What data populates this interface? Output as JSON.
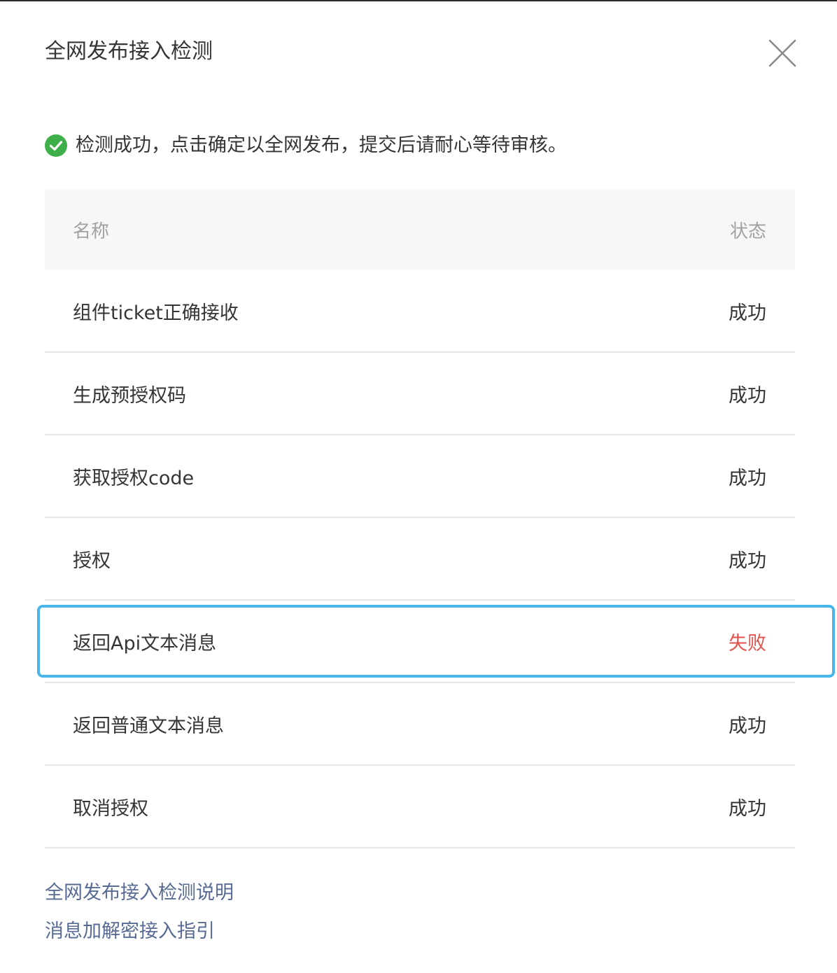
{
  "dialog": {
    "title": "全网发布接入检测",
    "close_icon": "close-icon"
  },
  "notice": {
    "icon": "check-circle-icon",
    "icon_color": "#3fb049",
    "text": "检测成功，点击确定以全网发布，提交后请耐心等待审核。"
  },
  "table": {
    "headers": {
      "name": "名称",
      "status": "状态"
    },
    "rows": [
      {
        "name": "组件ticket正确接收",
        "status": "成功"
      },
      {
        "name": "生成预授权码",
        "status": "成功"
      },
      {
        "name": "获取授权code",
        "status": "成功"
      },
      {
        "name": "授权",
        "status": "成功"
      },
      {
        "name": "返回Api文本消息",
        "status": "失败",
        "highlighted": true
      },
      {
        "name": "返回普通文本消息",
        "status": "成功"
      },
      {
        "name": "取消授权",
        "status": "成功"
      }
    ]
  },
  "links": [
    {
      "label": "全网发布接入检测说明"
    },
    {
      "label": "消息加解密接入指引"
    }
  ],
  "colors": {
    "link": "#576b95",
    "failed": "#e3514b",
    "highlight_border": "#4ab7ea",
    "header_bg": "#f6f7f9"
  }
}
